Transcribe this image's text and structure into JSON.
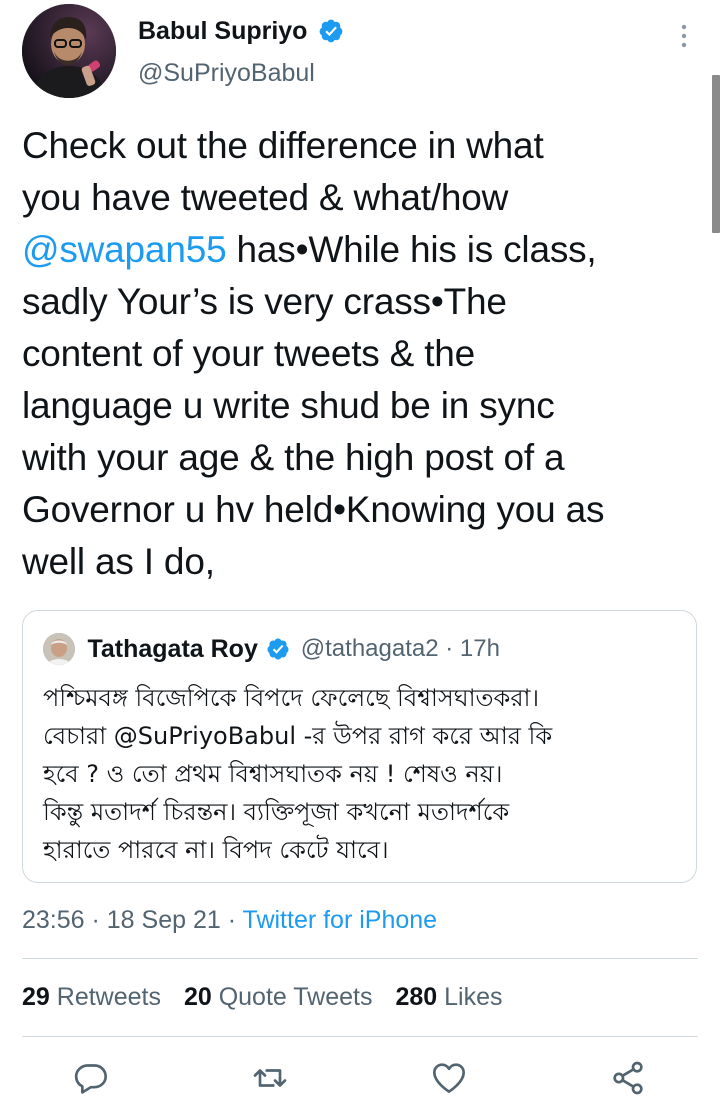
{
  "author": {
    "display_name": "Babul Supriyo",
    "handle": "@SuPriyoBabul"
  },
  "tweet": {
    "text_line1": "Check out the difference in what",
    "text_line2": "you have tweeted & what/how",
    "mention": "@swapan55",
    "text_after_mention": " has•While his is class,",
    "text_line4": "sadly Your’s is very crass•The",
    "text_line5": "content of your tweets & the",
    "text_line6": "language u write shud be in sync",
    "text_line7": "with your age & the high post of a",
    "text_line8": "Governor u hv held•Knowing you as",
    "text_line9": "well as I do,"
  },
  "quoted_tweet": {
    "display_name": "Tathagata Roy",
    "handle_time": "@tathagata2 · 17h",
    "line1": "পশ্চিমবঙ্গ বিজেপিকে বিপদে ফেলেছে বিশ্বাসঘাতকরা।",
    "line2": "বেচারা @SuPriyoBabul -র উপর রাগ করে আর কি",
    "line3": "হবে ? ও তো প্রথম বিশ্বাসঘাতক নয় ! শেষও নয়।",
    "line4": "কিন্তু মতাদর্শ চিরন্তন। ব্যক্তিপূজা কখনো মতাদর্শকে",
    "line5": "হারাতে পারবে না। বিপদ কেটে যাবে।"
  },
  "meta": {
    "time_date": "23:56 · 18 Sep 21 · ",
    "source": "Twitter for iPhone"
  },
  "stats": {
    "retweets_count": "29",
    "retweets_label": " Retweets",
    "quotes_count": "20",
    "quotes_label": " Quote Tweets",
    "likes_count": "280",
    "likes_label": " Likes"
  },
  "icons": {
    "reply": "reply-icon",
    "retweet": "retweet-icon",
    "like": "heart-icon",
    "share": "share-icon",
    "verified": "verified-badge-icon",
    "more": "more-vertical-icon"
  },
  "colors": {
    "accent": "#1d9bf0",
    "secondary_text": "#536471",
    "text": "#0f1419",
    "border": "#cfd9de"
  }
}
